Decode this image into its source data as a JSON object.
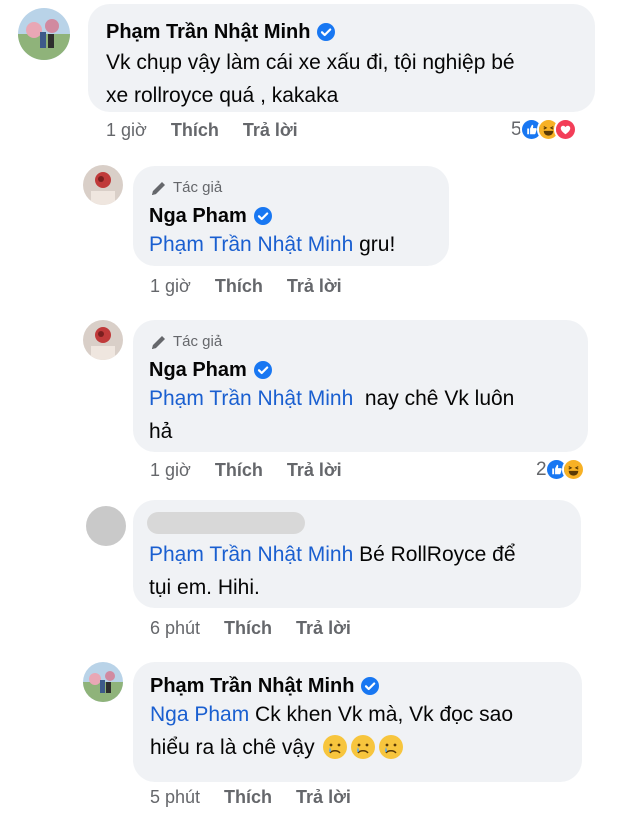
{
  "comments": [
    {
      "author": "Phạm Trần Nhật Minh",
      "verified": true,
      "lines": [
        "Vk chụp vậy làm cái xe xấu đi, tội nghiệp bé",
        "xe rollroyce quá , kakaka"
      ],
      "time": "1 giờ",
      "like_label": "Thích",
      "reply_label": "Trả lời",
      "reaction_count": "5",
      "reactions": [
        "like-icon",
        "haha-icon",
        "love-icon"
      ]
    },
    {
      "author_badge": "Tác giả",
      "author": "Nga Pham",
      "verified": true,
      "mention": "Phạm Trần Nhật Minh",
      "text": " gru!",
      "time": "1 giờ",
      "like_label": "Thích",
      "reply_label": "Trả lời"
    },
    {
      "author_badge": "Tác giả",
      "author": "Nga Pham",
      "verified": true,
      "mention": "Phạm Trần Nhật Minh",
      "text_line1": "  nay chê Vk luôn",
      "text_line2": "hả",
      "time": "1 giờ",
      "like_label": "Thích",
      "reply_label": "Trả lời",
      "reaction_count": "2",
      "reactions": [
        "like-icon",
        "haha-icon"
      ]
    },
    {
      "author_hidden": true,
      "mention": "Phạm Trần Nhật Minh",
      "text_line1": " Bé RollRoyce để",
      "text_line2": "tụi em. Hihi.",
      "time": "6 phút",
      "like_label": "Thích",
      "reply_label": "Trả lời"
    },
    {
      "author": "Phạm Trần Nhật Minh",
      "verified": true,
      "mention": "Nga Pham",
      "text_line1": " Ck khen Vk mà, Vk đọc sao",
      "text_line2": "hiểu ra là chê vậy",
      "emojis": [
        "crying-face-icon",
        "crying-face-icon",
        "crying-face-icon"
      ],
      "time": "5 phút",
      "like_label": "Thích",
      "reply_label": "Trả lời"
    }
  ],
  "colors": {
    "bubble": "#f0f2f5",
    "mention": "#1a5fd0",
    "meta": "#65676b",
    "verified": "#1877f2"
  }
}
